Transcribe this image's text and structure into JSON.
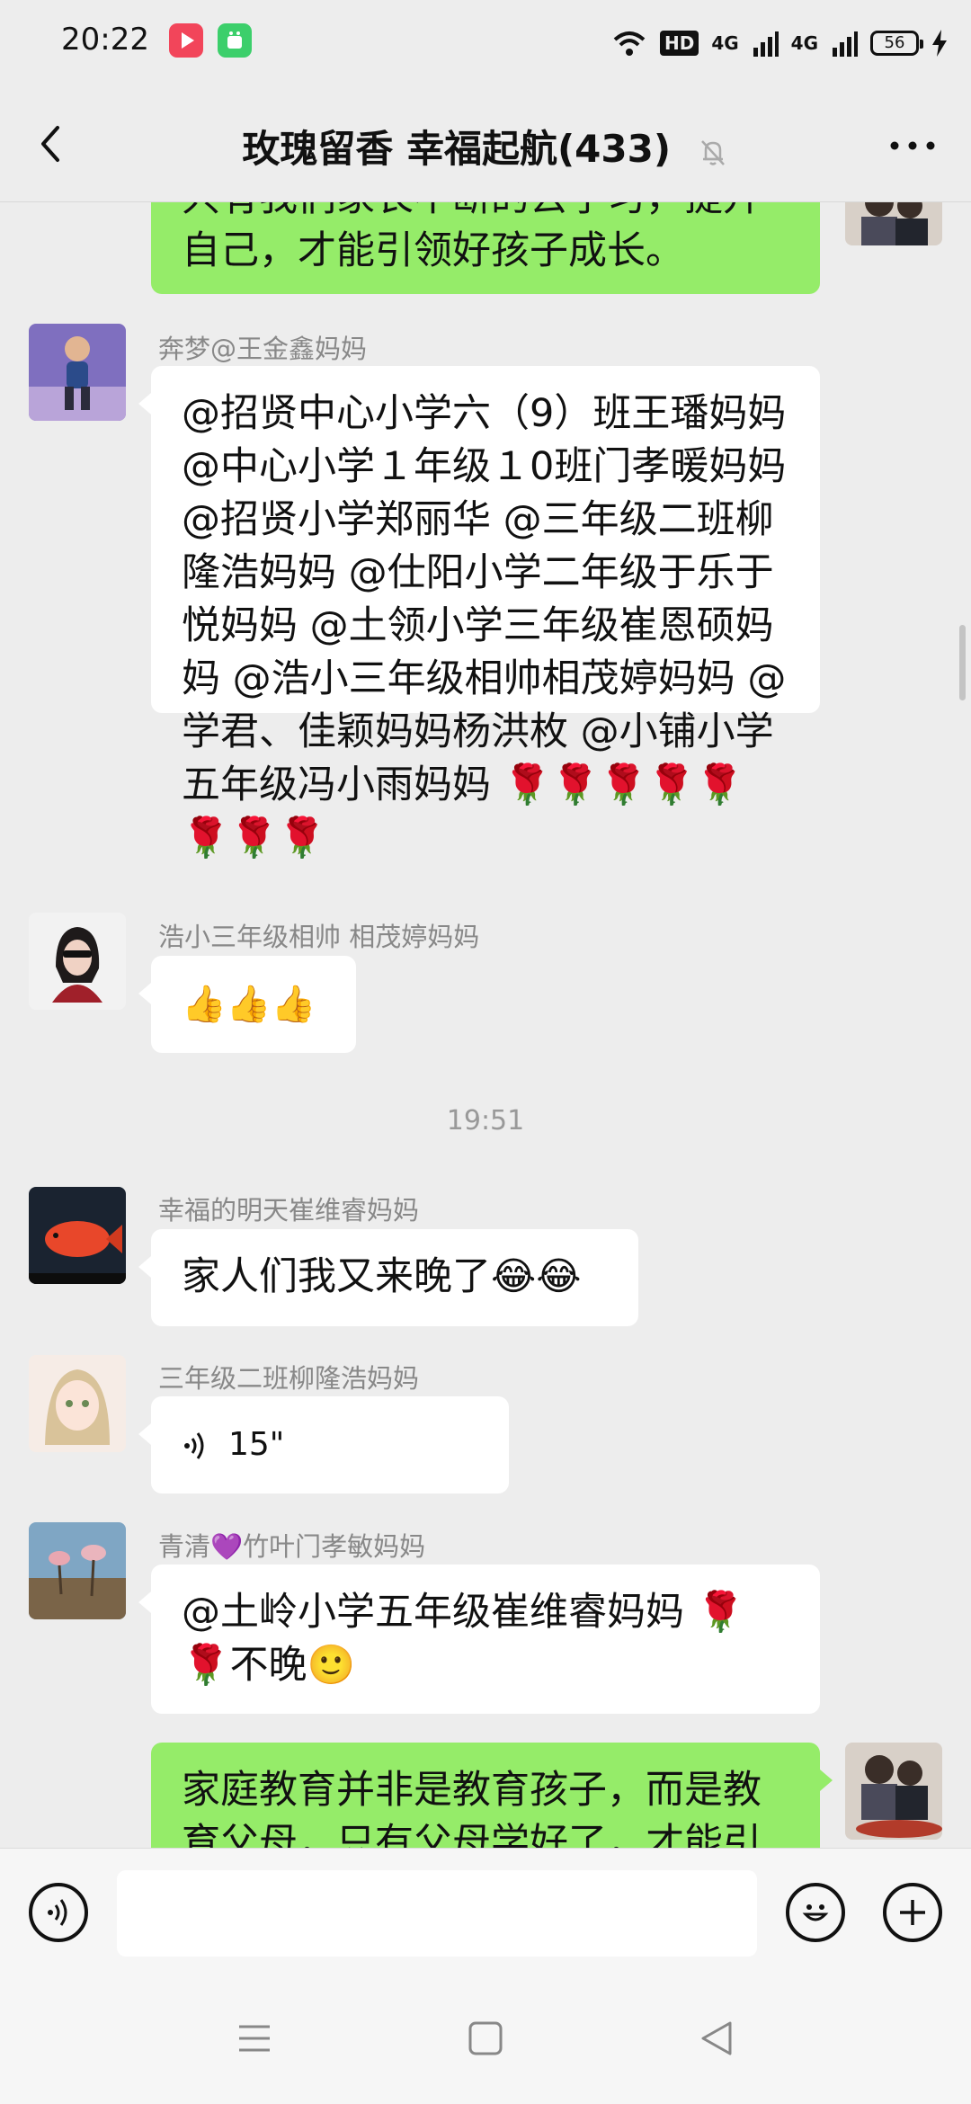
{
  "status_bar": {
    "time": "20:22",
    "network_hd": "HD",
    "network_1": "4G",
    "network_2": "4G",
    "battery": "56"
  },
  "header": {
    "title": "玫瑰留香  幸福起航(433)"
  },
  "messages": [
    {
      "id": "m0",
      "side": "right",
      "text": "只有我们家长不断的去学习，提升自己，才能引领好孩子成长。"
    },
    {
      "id": "m1",
      "side": "left",
      "sender": "奔梦@王金鑫妈妈",
      "text": "@招贤中心小学六（9）班王璠妈妈 @中心小学１年级１0班门孝暖妈妈 @招贤小学郑丽华 @三年级二班柳隆浩妈妈 @仕阳小学二年级于乐于悦妈妈 @土领小学三年级崔恩硕妈妈 @浩小三年级相帅相茂婷妈妈 @学君、佳颖妈妈杨洪枚 @小铺小学五年级冯小雨妈妈 🌹🌹🌹🌹🌹🌹🌹🌹"
    },
    {
      "id": "m2",
      "side": "left",
      "sender": "浩小三年级相帅  相茂婷妈妈",
      "text": "👍👍👍"
    },
    {
      "id": "ts1",
      "type": "timestamp",
      "text": "19:51"
    },
    {
      "id": "m3",
      "side": "left",
      "sender": "幸福的明天崔维睿妈妈",
      "text": "家人们我又来晚了😂😂"
    },
    {
      "id": "m4",
      "side": "left",
      "sender": "三年级二班柳隆浩妈妈",
      "voice_duration": "15\""
    },
    {
      "id": "m5",
      "side": "left",
      "sender": "青清💜竹叶门孝敏妈妈",
      "text": "@土岭小学五年级崔维睿妈妈 🌹🌹不晚🙂"
    },
    {
      "id": "m6",
      "side": "right",
      "text": "家庭教育并非是教育孩子，而是教育父母，只有父母学好了，才能引"
    }
  ],
  "colors": {
    "own_bubble": "#95ec69",
    "other_bubble": "#ffffff",
    "chat_background": "#ededed"
  },
  "icons": {
    "back": "chevron-left-icon",
    "mute": "bell-off-icon",
    "more": "more-horizontal-icon",
    "voice_input": "voice-wave-icon",
    "emoji": "smiley-icon",
    "plus": "plus-icon"
  }
}
